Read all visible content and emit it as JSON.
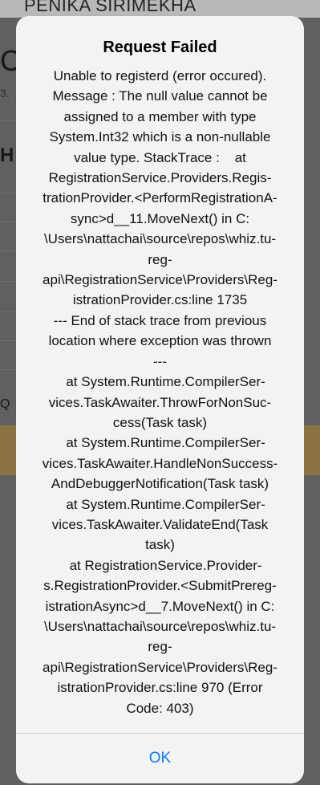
{
  "background": {
    "header_name": "PENIKA SIRIMEKHA",
    "left_chars": [
      "C",
      "3.",
      "H",
      "Q"
    ]
  },
  "alert": {
    "title": "Request Failed",
    "message_lines": [
      "Unable to registerd (error occured).",
      "Message : The null value cannot be",
      "assigned to a member with type",
      "System.Int32 which is a non-nullable",
      "value type. StackTrace :    at",
      "RegistrationService.Providers.Regis-",
      "trationProvider.<PerformRegistrationA-",
      "sync>d__11.MoveNext() in C:",
      "\\Users\\nattachai\\source\\repos\\whiz.tu-",
      "reg-",
      "api\\RegistrationService\\Providers\\Reg-",
      "istrationProvider.cs:line 1735",
      "--- End of stack trace from previous",
      "location where exception was thrown",
      "---",
      "   at System.Runtime.CompilerSer-",
      "vices.TaskAwaiter.ThrowForNonSuc-",
      "cess(Task task)",
      "   at System.Runtime.CompilerSer-",
      "vices.TaskAwaiter.HandleNonSuccess-",
      "AndDebuggerNotification(Task task)",
      "   at System.Runtime.CompilerSer-",
      "vices.TaskAwaiter.ValidateEnd(Task",
      "task)",
      "   at RegistrationService.Provider-",
      "s.RegistrationProvider.<SubmitPrereg-",
      "istrationAsync>d__7.MoveNext() in C:",
      "\\Users\\nattachai\\source\\repos\\whiz.tu-",
      "reg-",
      "api\\RegistrationService\\Providers\\Reg-",
      "istrationProvider.cs:line 970 (Error",
      "Code: 403)"
    ],
    "ok_label": "OK"
  },
  "colors": {
    "accent": "#0a7aff",
    "strip": "#f6b73c"
  }
}
